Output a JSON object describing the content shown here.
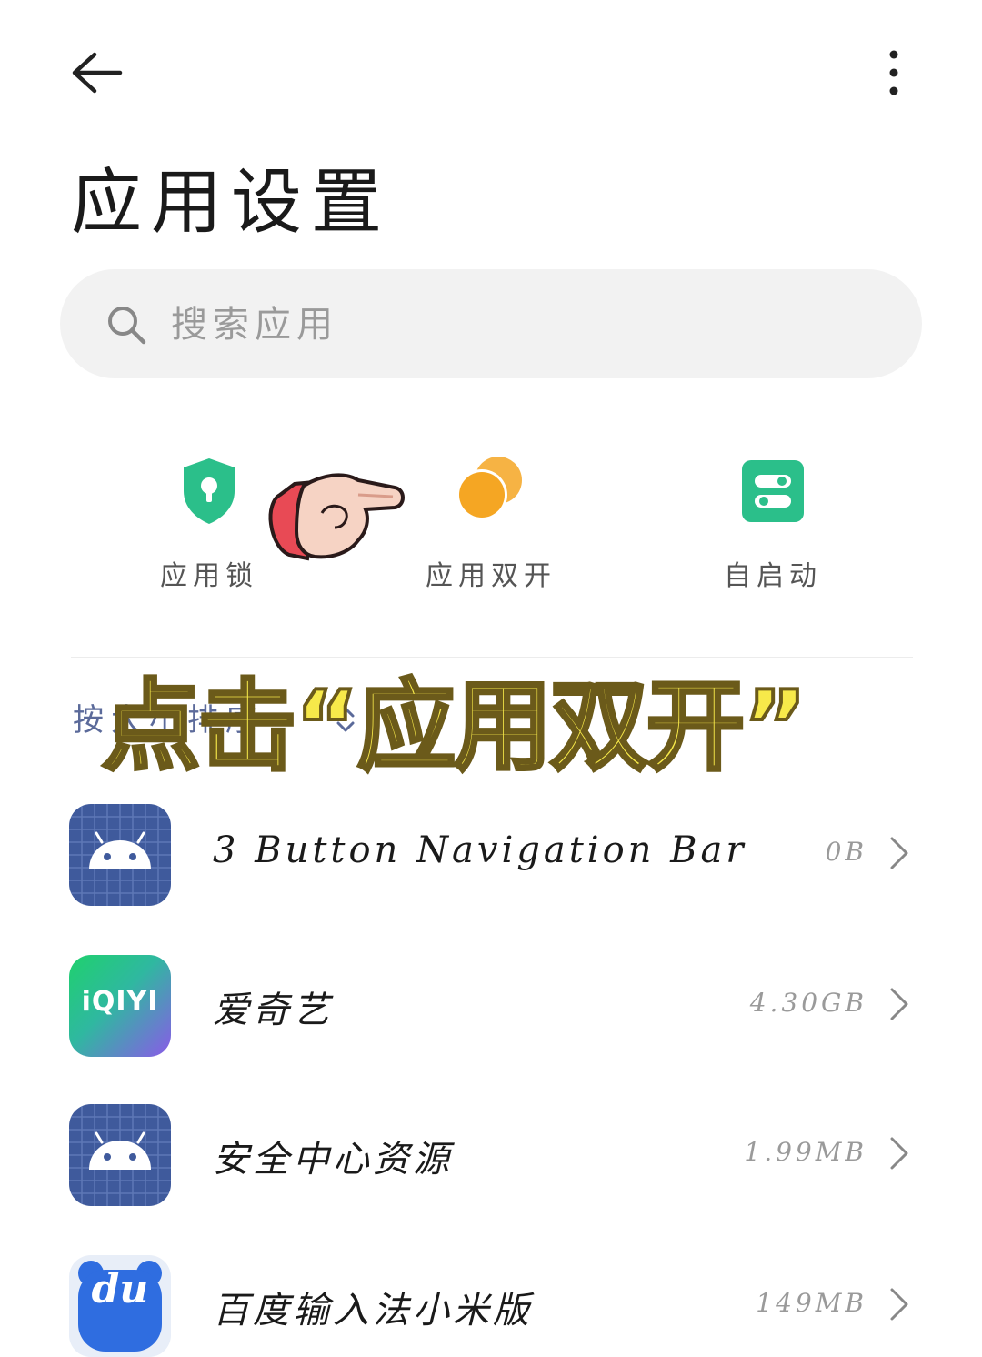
{
  "header": {
    "title": "应用设置",
    "back_icon": "arrow-left-icon",
    "more_icon": "more-vertical-icon"
  },
  "search": {
    "placeholder": "搜索应用",
    "icon": "search-icon"
  },
  "quick_actions": [
    {
      "label": "应用锁",
      "icon": "shield-keyhole-icon",
      "color": "#2bbf8a"
    },
    {
      "label": "应用双开",
      "icon": "dual-circle-icon",
      "color": "#f5a623"
    },
    {
      "label": "自启动",
      "icon": "toggle-switch-icon",
      "color": "#2bbf8a"
    }
  ],
  "sort": {
    "label": "按大小排序",
    "icon": "sort-chevron-icon"
  },
  "overlay_caption": "点击“应用双开”",
  "apps": [
    {
      "name": "3 Button Navigation Bar",
      "size": "0B",
      "icon": "android-icon"
    },
    {
      "name": "爱奇艺",
      "size": "4.30GB",
      "icon": "iqiyi-icon",
      "icon_text": "iQIYI"
    },
    {
      "name": "安全中心资源",
      "size": "1.99MB",
      "icon": "android-icon"
    },
    {
      "name": "百度输入法小米版",
      "size": "149MB",
      "icon": "baidu-input-icon",
      "icon_text": "du"
    }
  ],
  "colors": {
    "accent_green": "#2bbf8a",
    "accent_orange": "#f5a623",
    "caption_yellow": "#f7e94a",
    "android_tile": "#3f5a9c"
  }
}
